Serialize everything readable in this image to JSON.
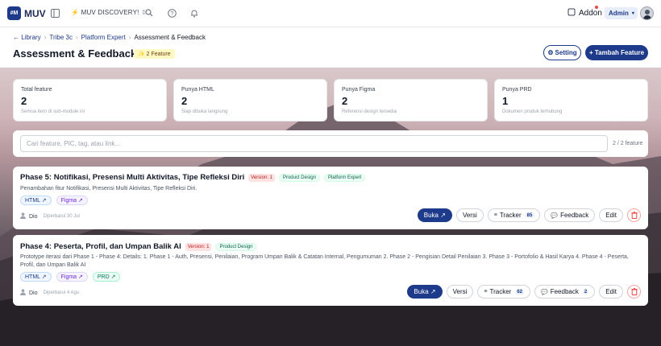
{
  "topbar": {
    "logo_mark": "#M",
    "logo_text": "MUV",
    "project": "⚡ MUV DISCOVERY!",
    "addon_label": "Addon",
    "role": "Admin"
  },
  "breadcrumb": [
    {
      "label": "← Library"
    },
    {
      "label": "Tribe 3c"
    },
    {
      "label": "Platform Expert"
    },
    {
      "label": "Assessment & Feedback"
    }
  ],
  "page": {
    "title": "Assessment & Feedback",
    "badge": "✨ 2 Feature",
    "setting_label": "Setting",
    "add_label": "+ Tambah Feature"
  },
  "stats": [
    {
      "label": "Total feature",
      "value": "2",
      "desc": "Semua item di sub-module ini"
    },
    {
      "label": "Punya HTML",
      "value": "2",
      "desc": "Siap dibuka langsung"
    },
    {
      "label": "Punya Figma",
      "value": "2",
      "desc": "Referensi design tersedia"
    },
    {
      "label": "Punya PRD",
      "value": "1",
      "desc": "Dokumen produk terhubung"
    }
  ],
  "search": {
    "placeholder": "Cari feature, PIC, tag, atau link...",
    "count": "2 / 2 feature"
  },
  "features": [
    {
      "title": "Phase 5: Notifikasi, Presensi Multi Aktivitas, Tipe Refleksi Diri",
      "version": "Version: 1",
      "tags": [
        "Product Design",
        "Platform Expert"
      ],
      "desc": "Penambahan fitur Notifikasi, Presensi Multi Aktivitas, Tipe Refleksi Diri.",
      "links": [
        "HTML ↗",
        "Figma ↗"
      ],
      "author": "Dio",
      "updated": "Diperbarui 30 Jul",
      "actions": {
        "open": "Buka ↗",
        "versions": "Versi",
        "tracker": "Tracker",
        "tracker_count": "85",
        "feedback": "Feedback",
        "edit": "Edit"
      }
    },
    {
      "title": "Phase 4: Peserta, Profil, dan Umpan Balik AI",
      "version": "Version: 1",
      "tags": [
        "Product Design"
      ],
      "desc": "Prototype iterasi dari Phase 1 - Phase 4: Details: 1. Phase 1 - Auth, Presensi, Penilaian, Program Umpan Balik & Catatan Internal, Pengumuman 2. Phase 2 - Pengisian Detail Penilaian 3. Phase 3 - Portofolio & Hasil Karya 4. Phase 4 - Peserta, Profil, dan Umpan Balik AI",
      "links": [
        "HTML ↗",
        "Figma ↗",
        "PRD ↗"
      ],
      "author": "Dio",
      "updated": "Diperbarui 4 Agu",
      "actions": {
        "open": "Buka ↗",
        "versions": "Versi",
        "tracker": "Tracker",
        "tracker_count": "62",
        "feedback": "Feedback",
        "feedback_count": "2",
        "edit": "Edit"
      }
    }
  ]
}
